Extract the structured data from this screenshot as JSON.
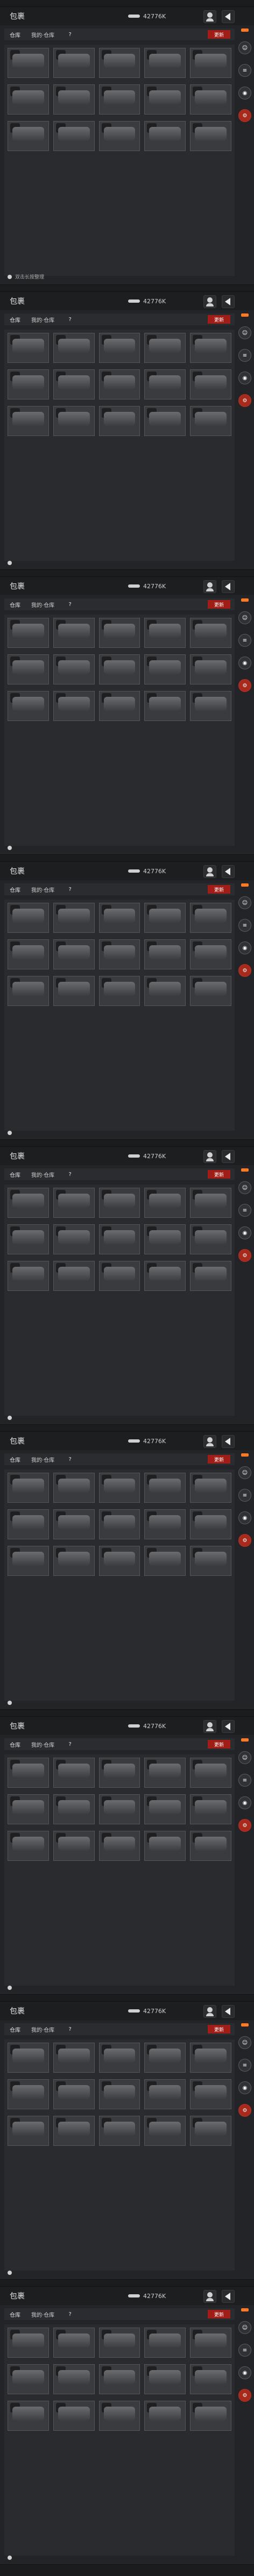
{
  "app": {
    "title": "包裹",
    "money": "42776K",
    "tabs": [
      "仓库",
      "我的·仓库",
      "?"
    ],
    "tab_red": "更新"
  },
  "panels": [
    {
      "bottom_note": "双击长按整理",
      "rows": [
        [
          {
            "label": "",
            "badge": ""
          },
          {
            "label": "",
            "badge": ""
          },
          {
            "label": "",
            "badge": ""
          },
          {
            "label": "",
            "badge": ""
          },
          {
            "label": "",
            "badge": ""
          }
        ],
        [
          {
            "label": "",
            "badge": ""
          },
          {
            "label": "",
            "badge": ""
          },
          {
            "label": "",
            "badge": ""
          },
          {
            "label": "",
            "badge": ""
          },
          {
            "label": "",
            "badge": ""
          }
        ],
        [
          {
            "label": "",
            "badge": ""
          },
          {
            "label": "",
            "badge": ""
          },
          {
            "label": "",
            "badge": ""
          },
          {
            "label": "",
            "badge": ""
          },
          {
            "label": "",
            "badge": ""
          }
        ]
      ]
    },
    {
      "bottom_note": "",
      "rows": [
        [
          {
            "label": "",
            "badge": ""
          },
          {
            "label": "",
            "badge": ""
          },
          {
            "label": "",
            "badge": ""
          },
          {
            "label": "",
            "badge": ""
          },
          {
            "label": "",
            "badge": ""
          }
        ],
        [
          {
            "label": "",
            "badge": ""
          },
          {
            "label": "",
            "badge": ""
          },
          {
            "label": "",
            "badge": ""
          },
          {
            "label": "",
            "badge": ""
          },
          {
            "label": "",
            "badge": ""
          }
        ],
        [
          {
            "label": "",
            "badge": ""
          },
          {
            "label": "",
            "badge": ""
          },
          {
            "label": "",
            "badge": ""
          },
          {
            "label": "",
            "badge": ""
          },
          {
            "label": "",
            "badge": ""
          }
        ]
      ]
    },
    {
      "bottom_note": "",
      "rows": [
        [
          {
            "label": "",
            "badge": ""
          },
          {
            "label": "",
            "badge": ""
          },
          {
            "label": "",
            "badge": ""
          },
          {
            "label": "",
            "badge": ""
          },
          {
            "label": "",
            "badge": ""
          }
        ],
        [
          {
            "label": "",
            "badge": ""
          },
          {
            "label": "",
            "badge": ""
          },
          {
            "label": "",
            "badge": ""
          },
          {
            "label": "",
            "badge": ""
          },
          {
            "label": "",
            "badge": ""
          }
        ],
        [
          {
            "label": "",
            "badge": ""
          },
          {
            "label": "",
            "badge": ""
          },
          {
            "label": "",
            "badge": ""
          },
          {
            "label": "",
            "badge": ""
          },
          {
            "label": "",
            "badge": ""
          }
        ]
      ]
    },
    {
      "bottom_note": "",
      "rows": [
        [
          {
            "label": "",
            "badge": ""
          },
          {
            "label": "",
            "badge": ""
          },
          {
            "label": "",
            "badge": ""
          },
          {
            "label": "",
            "badge": ""
          },
          {
            "label": "",
            "badge": ""
          }
        ],
        [
          {
            "label": "",
            "badge": ""
          },
          {
            "label": "",
            "badge": ""
          },
          {
            "label": "",
            "badge": ""
          },
          {
            "label": "",
            "badge": ""
          },
          {
            "label": "",
            "badge": ""
          }
        ],
        [
          {
            "label": "",
            "badge": ""
          },
          {
            "label": "",
            "badge": ""
          },
          {
            "label": "",
            "badge": ""
          },
          {
            "label": "",
            "badge": ""
          },
          {
            "label": "",
            "badge": ""
          }
        ]
      ]
    },
    {
      "bottom_note": "",
      "rows": [
        [
          {
            "label": "",
            "badge": ""
          },
          {
            "label": "",
            "badge": ""
          },
          {
            "label": "",
            "badge": ""
          },
          {
            "label": "",
            "badge": ""
          },
          {
            "label": "",
            "badge": ""
          }
        ],
        [
          {
            "label": "",
            "badge": ""
          },
          {
            "label": "",
            "badge": ""
          },
          {
            "label": "",
            "badge": ""
          },
          {
            "label": "",
            "badge": ""
          },
          {
            "label": "",
            "badge": ""
          }
        ],
        [
          {
            "label": "",
            "badge": ""
          },
          {
            "label": "",
            "badge": ""
          },
          {
            "label": "",
            "badge": ""
          },
          {
            "label": "",
            "badge": ""
          },
          {
            "label": "",
            "badge": ""
          }
        ]
      ]
    },
    {
      "bottom_note": "",
      "rows": [
        [
          {
            "label": "",
            "badge": ""
          },
          {
            "label": "",
            "badge": ""
          },
          {
            "label": "",
            "badge": ""
          },
          {
            "label": "",
            "badge": ""
          },
          {
            "label": "",
            "badge": ""
          }
        ],
        [
          {
            "label": "",
            "badge": ""
          },
          {
            "label": "",
            "badge": ""
          },
          {
            "label": "",
            "badge": ""
          },
          {
            "label": "",
            "badge": ""
          },
          {
            "label": "",
            "badge": ""
          }
        ],
        [
          {
            "label": "",
            "badge": ""
          },
          {
            "label": "",
            "badge": ""
          },
          {
            "label": "",
            "badge": ""
          },
          {
            "label": "",
            "badge": ""
          },
          {
            "label": "",
            "badge": ""
          }
        ]
      ]
    },
    {
      "bottom_note": "",
      "rows": [
        [
          {
            "label": "",
            "badge": ""
          },
          {
            "label": "",
            "badge": ""
          },
          {
            "label": "",
            "badge": ""
          },
          {
            "label": "",
            "badge": ""
          },
          {
            "label": "",
            "badge": ""
          }
        ],
        [
          {
            "label": "",
            "badge": ""
          },
          {
            "label": "",
            "badge": ""
          },
          {
            "label": "",
            "badge": ""
          },
          {
            "label": "",
            "badge": ""
          },
          {
            "label": "",
            "badge": ""
          }
        ],
        [
          {
            "label": "",
            "badge": ""
          },
          {
            "label": "",
            "badge": ""
          },
          {
            "label": "",
            "badge": ""
          },
          {
            "label": "",
            "badge": ""
          },
          {
            "label": "",
            "badge": ""
          }
        ]
      ]
    },
    {
      "bottom_note": "",
      "rows": [
        [
          {
            "label": "",
            "badge": ""
          },
          {
            "label": "",
            "badge": ""
          },
          {
            "label": "",
            "badge": ""
          },
          {
            "label": "",
            "badge": ""
          },
          {
            "label": "",
            "badge": ""
          }
        ],
        [
          {
            "label": "",
            "badge": ""
          },
          {
            "label": "",
            "badge": ""
          },
          {
            "label": "",
            "badge": ""
          },
          {
            "label": "",
            "badge": ""
          },
          {
            "label": "",
            "badge": ""
          }
        ],
        [
          {
            "label": "",
            "badge": ""
          },
          {
            "label": "",
            "badge": ""
          },
          {
            "label": "",
            "badge": ""
          },
          {
            "label": "",
            "badge": ""
          },
          {
            "label": "",
            "badge": ""
          }
        ]
      ]
    },
    {
      "bottom_note": "",
      "rows": [
        [
          {
            "label": "",
            "badge": ""
          },
          {
            "label": "",
            "badge": ""
          },
          {
            "label": "",
            "badge": ""
          },
          {
            "label": "",
            "badge": ""
          },
          {
            "label": "",
            "badge": ""
          }
        ],
        [
          {
            "label": "",
            "badge": ""
          },
          {
            "label": "",
            "badge": ""
          },
          {
            "label": "",
            "badge": ""
          },
          {
            "label": "",
            "badge": ""
          },
          {
            "label": "",
            "badge": ""
          }
        ],
        [
          {
            "label": "",
            "badge": ""
          },
          {
            "label": "",
            "badge": ""
          },
          {
            "label": "",
            "badge": ""
          },
          {
            "label": "",
            "badge": ""
          },
          {
            "label": "",
            "badge": ""
          }
        ]
      ]
    }
  ],
  "colors": {
    "background": "#1b1c1e",
    "panel": "#232427",
    "accent_red": "#a01e17",
    "accent_orange": "#ff7a22"
  },
  "icons": {
    "money": "money-icon",
    "profile": "profile-icon",
    "back": "back-icon",
    "settings": "gear-icon",
    "filter": "filter-icon",
    "camera": "camera-icon"
  }
}
